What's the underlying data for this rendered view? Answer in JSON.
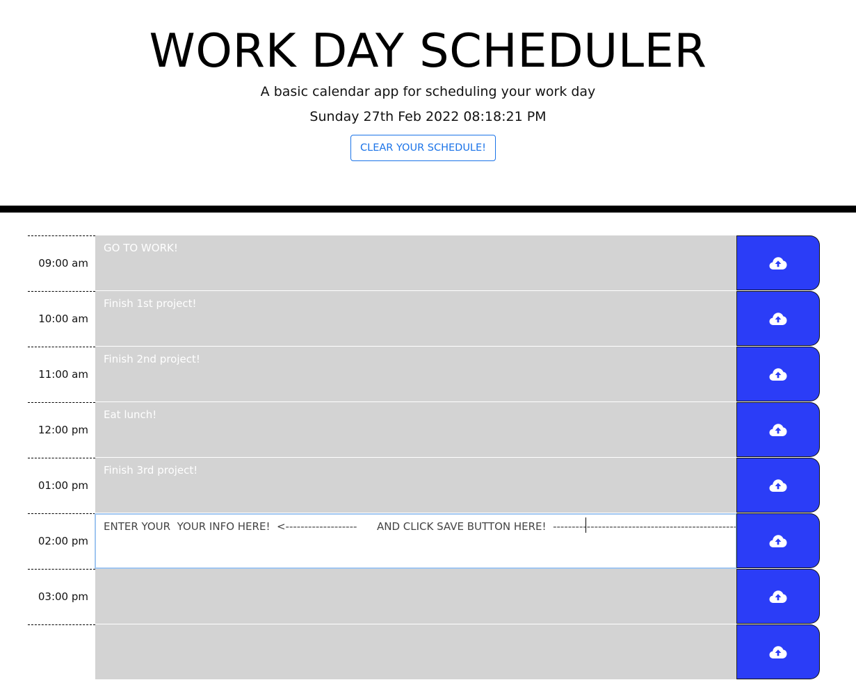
{
  "header": {
    "title": "WORK DAY SCHEDULER",
    "lead": "A basic calendar app for scheduling your work day",
    "current_date": "Sunday 27th Feb 2022 08:18:21 PM",
    "clear_button_label": "CLEAR YOUR SCHEDULE!"
  },
  "colors": {
    "past_block": "#d3d3d3",
    "present_block": "#ffffff",
    "save_button": "#2b3df7",
    "clear_button": "#1a73e8",
    "divider": "#000000"
  },
  "save_icon": "cloud-upload-icon",
  "schedule": [
    {
      "hour": "09:00 am",
      "text": "GO TO WORK!",
      "state": "past"
    },
    {
      "hour": "10:00 am",
      "text": "Finish 1st project!",
      "state": "past"
    },
    {
      "hour": "11:00 am",
      "text": "Finish 2nd project!",
      "state": "past"
    },
    {
      "hour": "12:00 pm",
      "text": "Eat lunch!",
      "state": "past"
    },
    {
      "hour": "01:00 pm",
      "text": "Finish 3rd project!",
      "state": "past"
    },
    {
      "hour": "02:00 pm",
      "text": "ENTER YOUR  YOUR INFO HERE!  <-------------------      AND CLICK SAVE BUTTON HERE!  ------------------------------------------------------->",
      "state": "present"
    },
    {
      "hour": "03:00 pm",
      "text": "",
      "state": "past"
    },
    {
      "hour": "",
      "text": "",
      "state": "past"
    }
  ]
}
